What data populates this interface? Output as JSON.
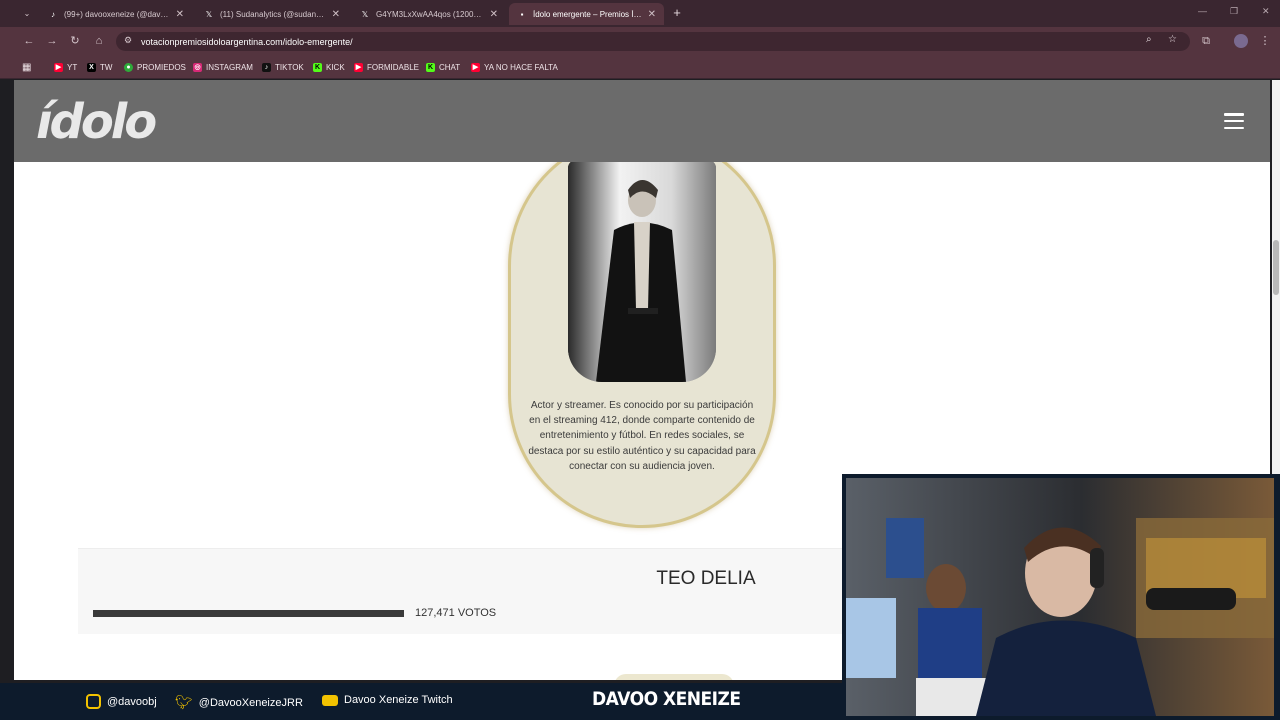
{
  "browser": {
    "tabs": [
      {
        "title": "(99+) davooxeneize (@davoox...",
        "icon": "tiktok-icon"
      },
      {
        "title": "(11) Sudanalytics (@sudanalytic...",
        "icon": "x-icon"
      },
      {
        "title": "G4YM3LxXwAA4qos (1200×704)",
        "icon": "x-icon"
      },
      {
        "title": "Ídolo emergente – Premios Ído...",
        "icon": "site-icon"
      }
    ],
    "url": "votacionpremiosidoloargentina.com/idolo-emergente/",
    "bookmarks": [
      {
        "label": "YT",
        "icon": "youtube-icon",
        "color": "#ff0033"
      },
      {
        "label": "TW",
        "icon": "x-icon",
        "color": "#000000"
      },
      {
        "label": "PROMIEDOS",
        "icon": "promiedos-icon",
        "color": "#2eaa3a"
      },
      {
        "label": "INSTAGRAM",
        "icon": "instagram-icon",
        "color": "#d62976"
      },
      {
        "label": "TIKTOK",
        "icon": "tiktok-icon",
        "color": "#111111"
      },
      {
        "label": "KICK",
        "icon": "kick-icon",
        "color": "#53fc18"
      },
      {
        "label": "FORMIDABLE",
        "icon": "youtube-icon",
        "color": "#ff0033"
      },
      {
        "label": "CHAT",
        "icon": "kick-icon",
        "color": "#53fc18"
      },
      {
        "label": "YA NO HACE FALTA",
        "icon": "youtube-icon",
        "color": "#ff0033"
      }
    ]
  },
  "site": {
    "logo": "ídolo",
    "candidate": {
      "bio": "Actor y streamer. Es conocido por su participación en el streaming 412, donde comparte contenido de entretenimiento y fútbol. En redes sociales, se destaca por su estilo auténtico y su capacidad para conectar con su audiencia joven.",
      "name": "TEO DELIA",
      "votes_label": "127,471 VOTOS",
      "vote_share": 1.0
    }
  },
  "overlay": {
    "socials": [
      {
        "label": "@davoobj",
        "icon": "instagram-icon"
      },
      {
        "label": "@DavooXeneizeJRR",
        "icon": "twitter-bird-icon"
      },
      {
        "label": "Davoo Xeneize Twitch",
        "icon": "youtube-icon"
      }
    ],
    "brand": "DAVOO XENEIZE"
  }
}
